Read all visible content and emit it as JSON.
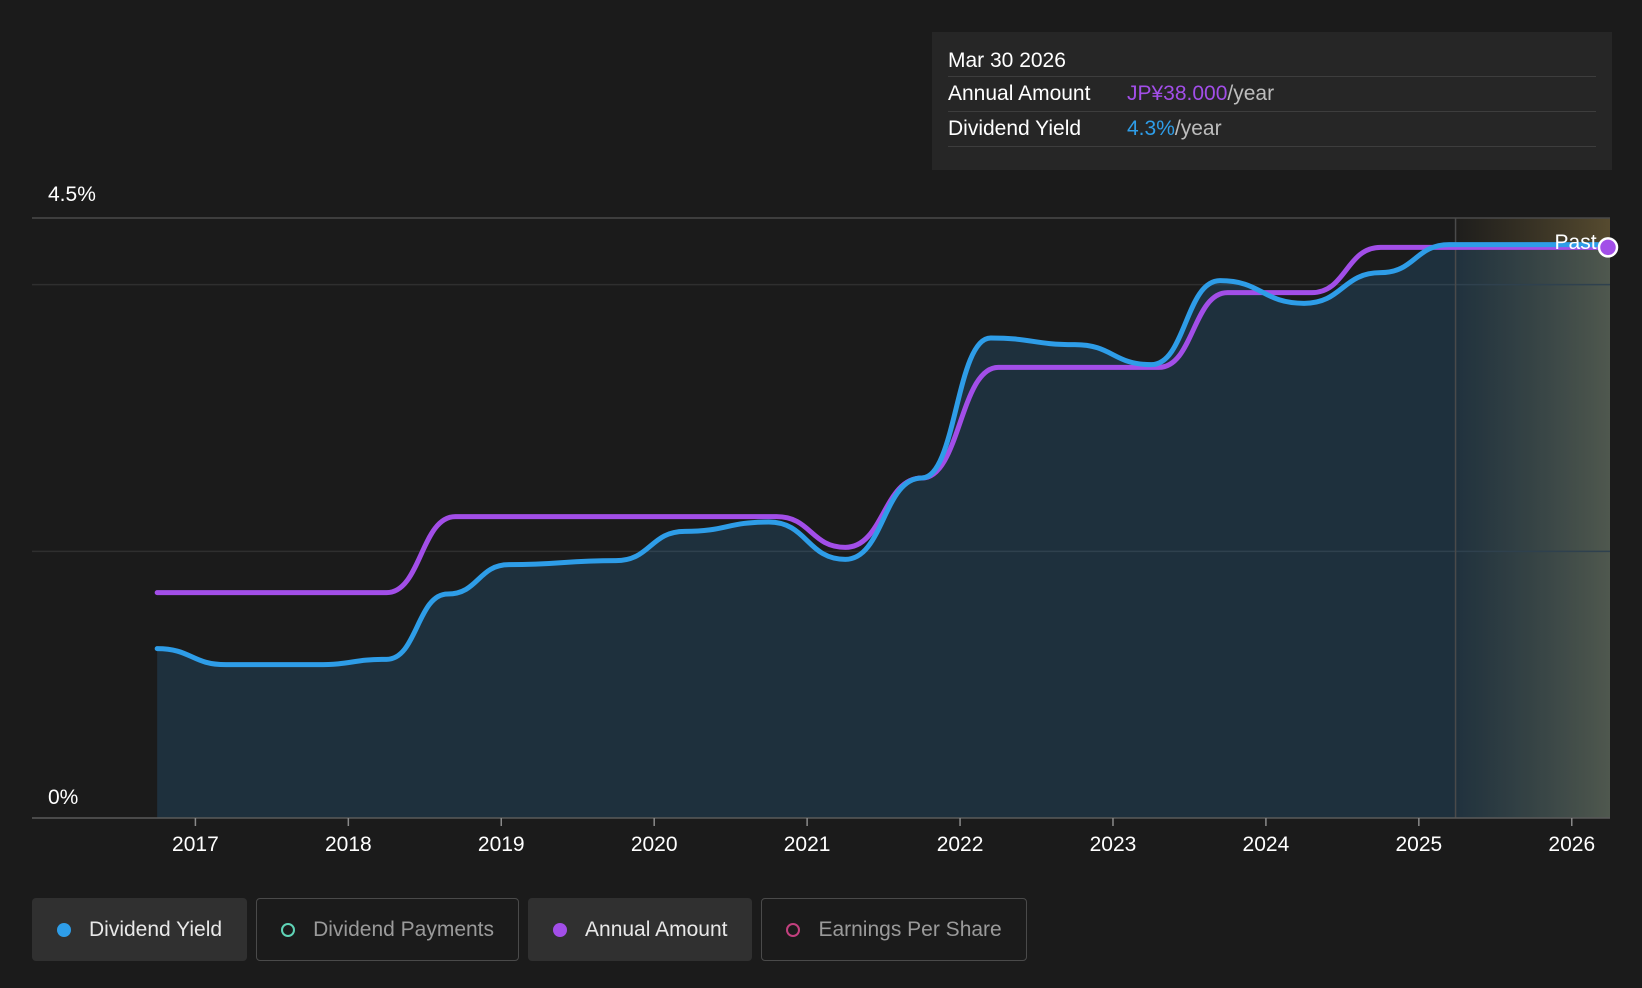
{
  "tooltip": {
    "date": "Mar 30 2026",
    "rows": [
      {
        "label": "Annual Amount",
        "value": "JP¥38.000",
        "unit": "/year",
        "color": "#a24ee8"
      },
      {
        "label": "Dividend Yield",
        "value": "4.3%",
        "unit": "/year",
        "color": "#2e9de8"
      }
    ]
  },
  "past_label": "Past",
  "legend": [
    {
      "label": "Dividend Yield",
      "color": "#2e9de8",
      "filled": true,
      "active": true
    },
    {
      "label": "Dividend Payments",
      "color": "#5fd3b6",
      "filled": false,
      "active": false
    },
    {
      "label": "Annual Amount",
      "color": "#a24ee8",
      "filled": true,
      "active": true
    },
    {
      "label": "Earnings Per Share",
      "color": "#c2407e",
      "filled": false,
      "active": false
    }
  ],
  "chart_data": {
    "type": "line",
    "y_tick_labels": [
      "4.5%",
      "0%"
    ],
    "ylim": [
      0,
      4.5
    ],
    "xlim": [
      2016.35,
      2026.25
    ],
    "x_ticks": [
      2017,
      2018,
      2019,
      2020,
      2021,
      2022,
      2023,
      2024,
      2025,
      2026
    ],
    "x_tick_labels": [
      "2017",
      "2018",
      "2019",
      "2020",
      "2021",
      "2022",
      "2023",
      "2024",
      "2025",
      "2026"
    ],
    "past_boundary_x": 2025.24,
    "grid": true,
    "series": [
      {
        "name": "Dividend Yield",
        "color": "#2e9de8",
        "fill": true,
        "points": [
          [
            2016.75,
            1.27
          ],
          [
            2017.2,
            1.15
          ],
          [
            2017.8,
            1.15
          ],
          [
            2018.25,
            1.19
          ],
          [
            2018.65,
            1.68
          ],
          [
            2019.05,
            1.9
          ],
          [
            2019.75,
            1.93
          ],
          [
            2020.2,
            2.15
          ],
          [
            2020.75,
            2.22
          ],
          [
            2021.25,
            1.94
          ],
          [
            2021.75,
            2.55
          ],
          [
            2022.2,
            3.6
          ],
          [
            2022.75,
            3.55
          ],
          [
            2023.25,
            3.4
          ],
          [
            2023.7,
            4.03
          ],
          [
            2024.25,
            3.86
          ],
          [
            2024.75,
            4.09
          ],
          [
            2025.2,
            4.3
          ],
          [
            2025.7,
            4.3
          ],
          [
            2026.25,
            4.3
          ]
        ]
      },
      {
        "name": "Annual Amount",
        "color": "#a24ee8",
        "fill": false,
        "points": [
          [
            2016.75,
            1.69
          ],
          [
            2018.25,
            1.69
          ],
          [
            2018.7,
            2.26
          ],
          [
            2020.8,
            2.26
          ],
          [
            2021.25,
            2.03
          ],
          [
            2021.75,
            2.55
          ],
          [
            2022.25,
            3.38
          ],
          [
            2023.3,
            3.38
          ],
          [
            2023.75,
            3.94
          ],
          [
            2024.3,
            3.94
          ],
          [
            2024.75,
            4.28
          ],
          [
            2025.25,
            4.28
          ],
          [
            2026.25,
            4.28
          ]
        ]
      }
    ]
  }
}
